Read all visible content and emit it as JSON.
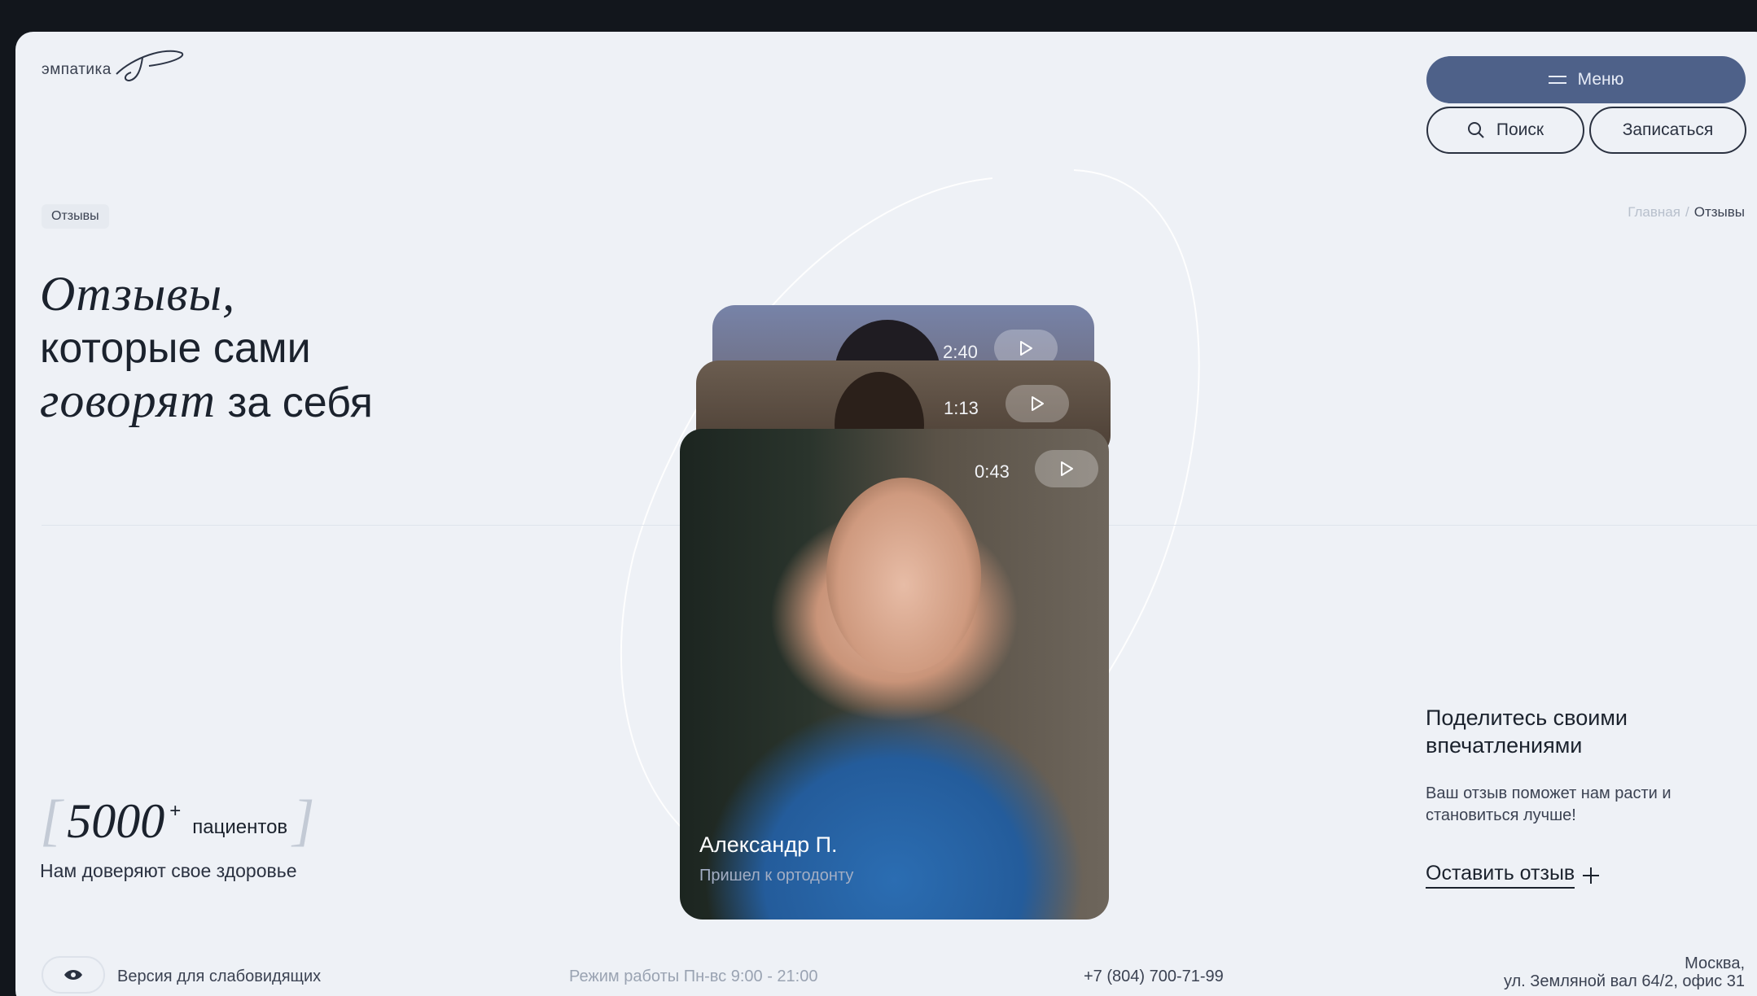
{
  "header": {
    "logo_text": "эмпатика",
    "menu_label": "Меню",
    "search_label": "Поиск",
    "signup_label": "Записаться"
  },
  "breadcrumb": {
    "page_tag": "Отзывы",
    "home": "Главная",
    "separator": "/",
    "current": "Отзывы"
  },
  "hero": {
    "line1_serif": "Отзывы,",
    "line2": "которые сами",
    "line3_serif": "говорят",
    "line3_rest": " за себя"
  },
  "stats": {
    "number": "5000",
    "plus": "+",
    "unit": "пациентов",
    "caption": "Нам доверяют свое здоровье"
  },
  "videos": [
    {
      "duration": "2:40"
    },
    {
      "duration": "1:13"
    },
    {
      "duration": "0:43",
      "name": "Александр П.",
      "role": "Пришел к ортодонту"
    }
  ],
  "cta": {
    "title": "Поделитесь своими впечатлениями",
    "text": "Ваш отзыв поможет нам расти и становиться лучше!",
    "link_label": "Оставить отзыв",
    "link_icon": "+"
  },
  "footer": {
    "accessibility_label": "Версия для слабовидящих",
    "hours": "Режим работы  Пн-вс 9:00 - 21:00",
    "phone": "+7 (804) 700-71-99",
    "address_line1": "Москва,",
    "address_line2": "ул. Земляной вал 64/2, офис 31"
  },
  "colors": {
    "background": "#eef1f6",
    "accent": "#4e6189",
    "text": "#1b222d"
  },
  "icons": [
    "menu-icon",
    "search-icon",
    "play-icon",
    "plus-icon",
    "eye-icon",
    "logo-signature"
  ]
}
